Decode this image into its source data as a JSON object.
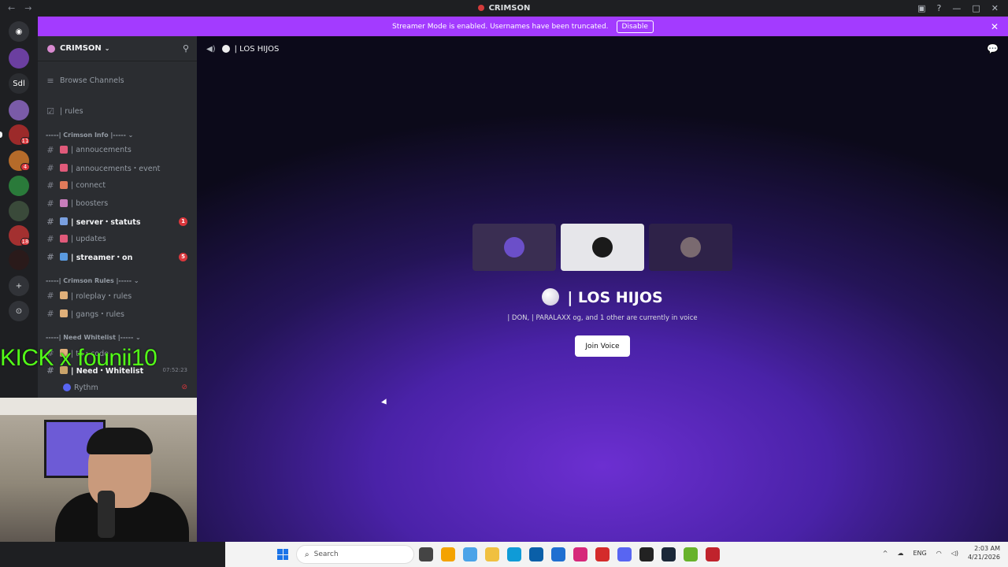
{
  "titlebar": {
    "title": "CRIMSON",
    "back": "←",
    "forward": "→"
  },
  "banner": {
    "text": "Streamer Mode is enabled. Usernames have been truncated.",
    "button": "Disable",
    "close": "✕"
  },
  "rail": {
    "sdl_label": "Sdl",
    "badges": [
      "11",
      "4",
      "18"
    ]
  },
  "server": {
    "name": "CRIMSON",
    "chevron": "⌄"
  },
  "sidebar": {
    "browse": "Browse Channels",
    "rules": "|   rules",
    "cat1": "-----| Crimson Info |----- ⌄",
    "cat2": "-----| Crimson Rules |----- ⌄",
    "cat3": "-----| Need Whitelist |----- ⌄",
    "channels": [
      {
        "label": "|  annoucements"
      },
      {
        "label": "|  annoucements・event"
      },
      {
        "label": "|  connect"
      },
      {
        "label": "|  boosters"
      },
      {
        "label": "|  server・statuts",
        "count": "1"
      },
      {
        "label": "|  updates"
      },
      {
        "label": "|  streamer・on",
        "count": "5"
      },
      {
        "label": "|  roleplay・rules"
      },
      {
        "label": "|  gangs・rules"
      },
      {
        "label": "|  tx・code"
      },
      {
        "label": "|  Need・Whitelist"
      }
    ],
    "voice_label": "Rythm",
    "timestamp": "07:52:23"
  },
  "overlay": {
    "kick": "KICK x founii10"
  },
  "main": {
    "channel": "| LOS HIJOS",
    "title": "| LOS HIJOS",
    "subtitle": "| DON,   | PARALAXX og, and 1 other are currently in voice",
    "join": "Join Voice"
  },
  "taskbar": {
    "search": "Search",
    "lang": "ENG",
    "time": "2:03 AM",
    "date": "4/21/2026"
  },
  "colors": {
    "accent": "#a33bff",
    "badge": "#da373c",
    "kick": "#53fc18"
  }
}
